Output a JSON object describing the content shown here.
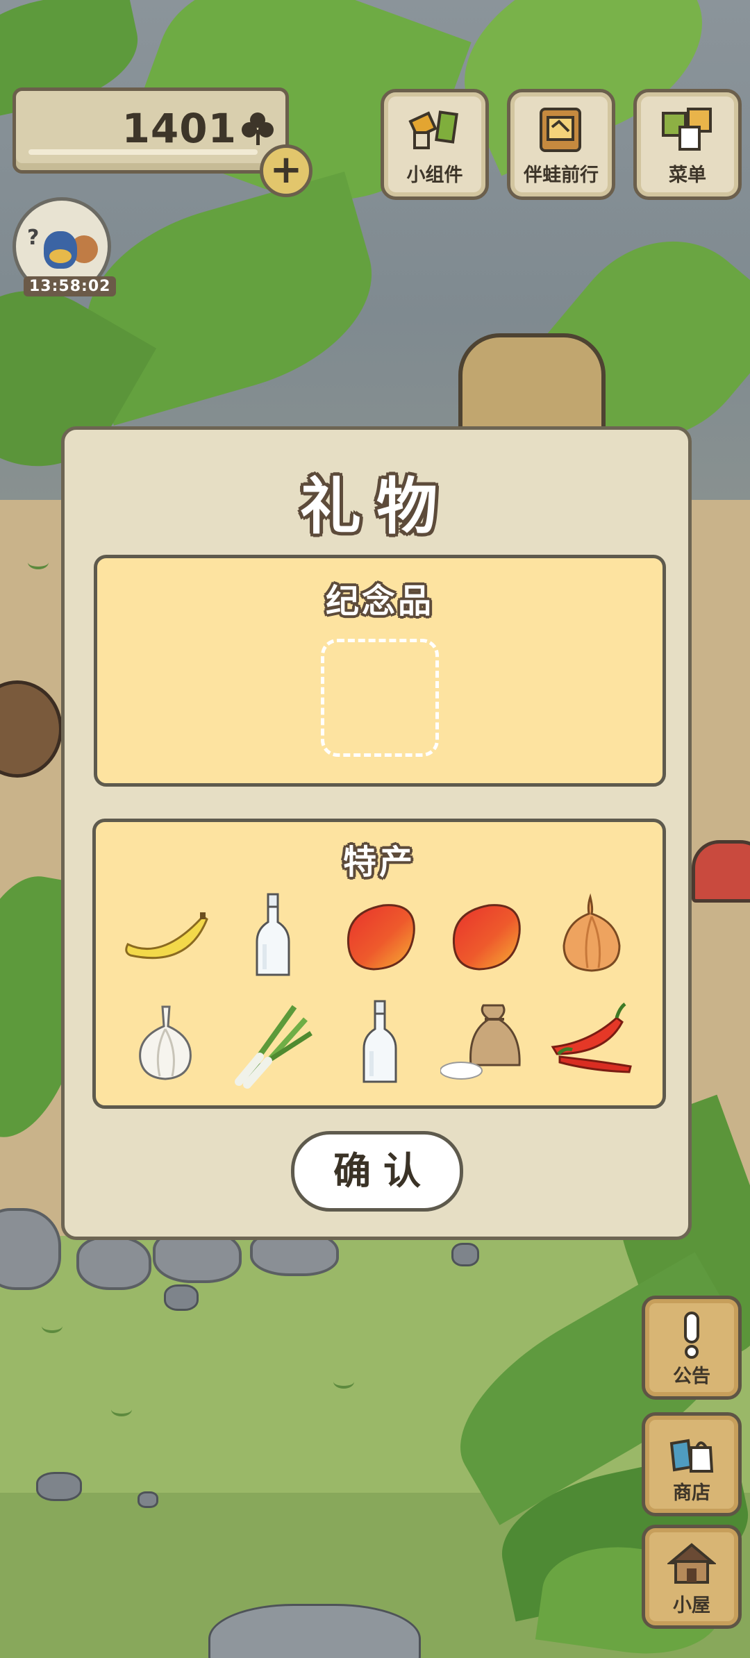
{
  "hud": {
    "clover_count": "1401",
    "clover_icon": "clover-icon",
    "plus_icon": "+",
    "timer": "13:58:02"
  },
  "top_buttons": [
    {
      "label": "小组件",
      "icon": "widget-icon"
    },
    {
      "label": "伴蛙前行",
      "icon": "travel-journal-icon"
    },
    {
      "label": "菜单",
      "icon": "menu-icon"
    }
  ],
  "dialog": {
    "title": "礼物",
    "souvenir_section": {
      "title": "纪念品",
      "slot_state": "empty"
    },
    "specialty_section": {
      "title": "特产",
      "items": [
        {
          "icon": "banana-icon"
        },
        {
          "icon": "glass-bottle-icon"
        },
        {
          "icon": "mango-icon"
        },
        {
          "icon": "mango-icon"
        },
        {
          "icon": "onion-icon"
        },
        {
          "icon": "garlic-icon"
        },
        {
          "icon": "scallion-icon"
        },
        {
          "icon": "glass-bottle-icon"
        },
        {
          "icon": "rice-sack-icon"
        },
        {
          "icon": "chili-pepper-icon"
        }
      ]
    },
    "confirm_label": "确认"
  },
  "side_buttons": [
    {
      "label": "公告",
      "icon": "exclamation-icon"
    },
    {
      "label": "商店",
      "icon": "shop-bags-icon"
    },
    {
      "label": "小屋",
      "icon": "house-icon"
    }
  ],
  "colors": {
    "dialog_bg": "#e6dec4",
    "section_bg": "#fde3a0",
    "outline": "#5e5a4d",
    "button_wood": "#d8b574"
  }
}
